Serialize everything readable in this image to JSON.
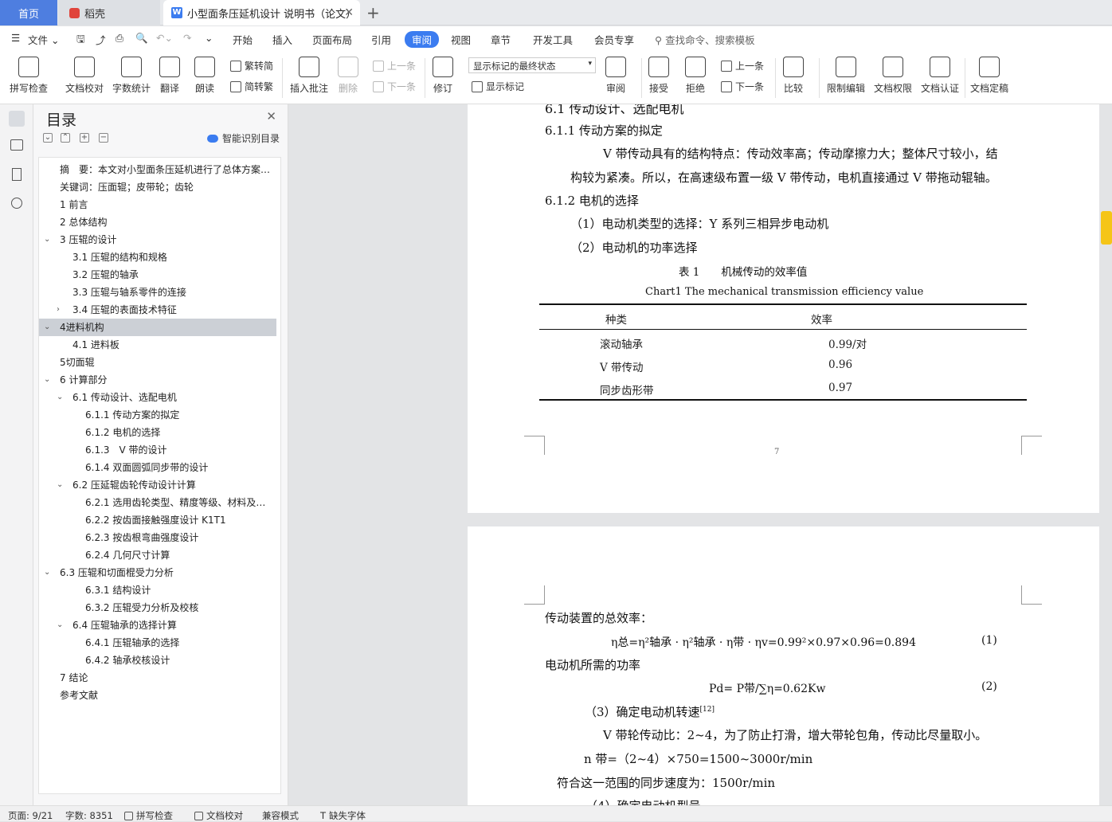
{
  "tabs": {
    "home": "首页",
    "daoke": "稻壳",
    "doc": "小型面条压延机设计 说明书（论文）"
  },
  "menu": {
    "file": "文件",
    "items": [
      "开始",
      "插入",
      "页面布局",
      "引用",
      "审阅",
      "视图",
      "章节",
      "开发工具",
      "会员专享"
    ],
    "search": "查找命令、搜索模板"
  },
  "ribbon": {
    "spellcheck": "拼写检查",
    "proofread": "文档校对",
    "wordcount": "字数统计",
    "translate": "翻译",
    "read": "朗读",
    "trad": "繁转简",
    "simp": "简转繁",
    "insert_comment": "插入批注",
    "delete": "删除",
    "prev": "上一条",
    "next": "下一条",
    "revise": "修订",
    "mark_state": "显示标记的最终状态",
    "show_mark": "显示标记",
    "review": "审阅",
    "accept": "接受",
    "reject": "拒绝",
    "prev2": "上一条",
    "next2": "下一条",
    "compare": "比较",
    "restrict": "限制编辑",
    "rights": "文档权限",
    "certify": "文档认证",
    "finalize": "文档定稿"
  },
  "toc": {
    "title": "目录",
    "smart": "智能识别目录",
    "items": [
      "摘　要：本文对小型面条压延机进行了总体方案…",
      "关键词：压面辊；皮带轮；齿轮",
      "1 前言",
      "2 总体结构",
      "3 压辊的设计",
      "3.1 压辊的结构和规格",
      "3.2 压辊的轴承",
      "3.3 压辊与轴系零件的连接",
      "3.4 压辊的表面技术特征",
      "4进料机构",
      "4.1 进料板",
      "5切面辊",
      "6 计算部分",
      "6.1 传动设计、选配电机",
      "6.1.1 传动方案的拟定",
      "6.1.2 电机的选择",
      "6.1.3　V 带的设计",
      "6.1.4 双面圆弧同步带的设计",
      "6.2 压延辊齿轮传动设计计算",
      "6.2.1 选用齿轮类型、精度等级、材料及…",
      "6.2.2 按齿面接触强度设计 K1T1",
      "6.2.3 按齿根弯曲强度设计",
      "6.2.4 几何尺寸计算",
      "6.3 压辊和切面棍受力分析",
      "6.3.1 结构设计",
      "6.3.2 压辊受力分析及校核",
      "6.4 压辊轴承的选择计算",
      "6.4.1 压辊轴承的选择",
      "6.4.2 轴承校核设计",
      "7 结论",
      "参考文献"
    ]
  },
  "page1": {
    "h61": "6.1  传动设计、选配电机",
    "h611": "6.1.1 传动方案的拟定",
    "p1": "V 带传动具有的结构特点：传动效率高；传动摩擦力大；整体尺寸较小，结",
    "p2": "构较为紧凑。所以，在高速级布置一级 V 带传动，电机直接通过 V 带拖动辊轴。",
    "h612": "6.1.2  电机的选择",
    "l1": "（1）电动机类型的选择：Y 系列三相异步电动机",
    "l2": "（2）电动机的功率选择",
    "cap_cn": "表 1　　机械传动的效率值",
    "cap_en": "Chart1 The mechanical transmission efficiency value",
    "th1": "种类",
    "th2": "效率",
    "rows": [
      [
        "滚动轴承",
        "0.99/对"
      ],
      [
        "V 带传动",
        "0.96"
      ],
      [
        "同步齿形带",
        "0.97"
      ]
    ],
    "pagenum": "7"
  },
  "page2": {
    "a1": "传动装置的总效率：",
    "eq1": "η总=η²轴承 · η²轴承 · η带 · ηv=0.99²×0.97×0.96=0.894",
    "eq1n": "(1)",
    "a2": "电动机所需的功率",
    "eq2": "Pd= P带/∑η=0.62Kw",
    "eq2n": "(2)",
    "a3": "（3）确定电动机转速",
    "a3ref": "[12]",
    "a4": "V 带轮传动比：2~4，为了防止打滑，增大带轮包角，传动比尽量取小。",
    "a5": "n 带=（2~4）×750=1500~3000r/min",
    "a6": "符合这一范围的同步速度为：1500r/min",
    "a7": "（4）确定电动机型号"
  },
  "status": {
    "page": "页面: 9/21",
    "words": "字数: 8351",
    "spell": "拼写检查",
    "proof": "文档校对",
    "compat": "兼容模式",
    "font": "缺失字体"
  },
  "colors": {
    "accent": "#3b7cf0",
    "highlight": "#f5c518"
  }
}
